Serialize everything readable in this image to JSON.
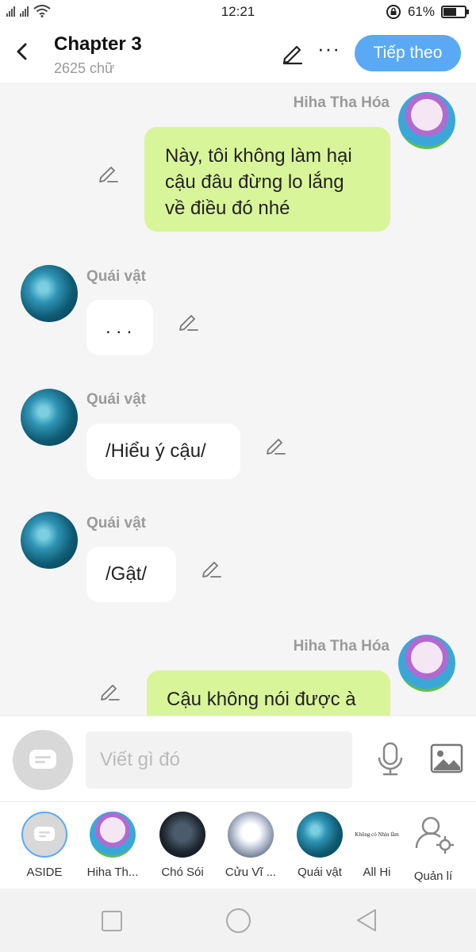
{
  "status_bar": {
    "time": "12:21",
    "battery_percent": "61%",
    "battery_level": 0.61
  },
  "header": {
    "title": "Chapter 3",
    "word_count": "2625 chữ",
    "next_button": "Tiếp theo",
    "more": "···"
  },
  "messages": [
    {
      "side": "right",
      "sender": "Hiha Tha Hóa",
      "lines": [
        "Này, tôi không làm hại",
        "cậu đâu đừng lo lắng",
        "về điều đó nhé"
      ]
    },
    {
      "side": "left",
      "sender": "Quái vật",
      "lines": [
        ". . ."
      ]
    },
    {
      "side": "left",
      "sender": "Quái vật",
      "lines": [
        "/Hiểu ý cậu/"
      ]
    },
    {
      "side": "left",
      "sender": "Quái vật",
      "lines": [
        "/Gật/"
      ]
    },
    {
      "side": "right",
      "sender": "Hiha Tha Hóa",
      "lines": [
        "Cậu không nói được à"
      ]
    }
  ],
  "input": {
    "placeholder": "Viết gì đó"
  },
  "characters": [
    {
      "label": "ASIDE"
    },
    {
      "label": "Hiha Th..."
    },
    {
      "label": "Chó Sói"
    },
    {
      "label": "Cửu Vĩ ..."
    },
    {
      "label": "Quái vật"
    },
    {
      "label": "All Hi",
      "avatar_text": "Không có Nhìn lầm"
    },
    {
      "label": "Quản lí"
    }
  ],
  "colors": {
    "accent": "#5aa9f5",
    "right_bubble": "#d9f59a",
    "left_bubble": "#ffffff",
    "background": "#f5f5f5"
  }
}
